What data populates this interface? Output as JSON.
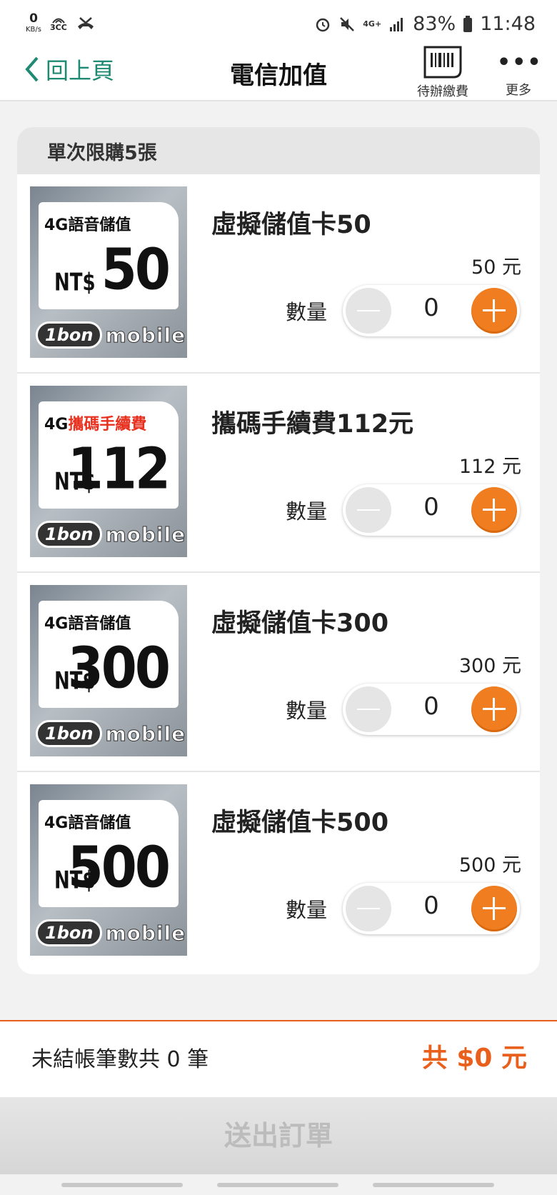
{
  "status_bar": {
    "speed_value": "0",
    "speed_unit": "KB/s",
    "cc_label": "3CC",
    "network": "4G+",
    "battery": "83%",
    "time": "11:48"
  },
  "header": {
    "back_label": "回上頁",
    "title": "電信加值",
    "pending_label": "待辦繳費",
    "more_label": "更多"
  },
  "card": {
    "limit_text": "單次限購5張",
    "qty_label": "數量",
    "items": [
      {
        "thumb_title": "4G語音儲值",
        "thumb_title_red": "",
        "thumb_prefix": "NT$",
        "thumb_amount": "50",
        "name": "虛擬儲值卡50",
        "price": "50 元",
        "qty": "0"
      },
      {
        "thumb_title": "4G",
        "thumb_title_red": "攜碼手續費",
        "thumb_prefix": "NT$",
        "thumb_amount": "112",
        "name": "攜碼手續費112元",
        "price": "112 元",
        "qty": "0"
      },
      {
        "thumb_title": "4G語音儲值",
        "thumb_title_red": "",
        "thumb_prefix": "NT$",
        "thumb_amount": "300",
        "name": "虛擬儲值卡300",
        "price": "300 元",
        "qty": "0"
      },
      {
        "thumb_title": "4G語音儲值",
        "thumb_title_red": "",
        "thumb_prefix": "NT$",
        "thumb_amount": "500",
        "name": "虛擬儲值卡500",
        "price": "500 元",
        "qty": "0"
      }
    ],
    "logo_pill": "1bon",
    "logo_word": "mobile"
  },
  "summary": {
    "left": "未結帳筆數共 0 筆",
    "right": "共 $0 元"
  },
  "submit_label": "送出訂單",
  "colors": {
    "accent": "#f07d1f",
    "brand_green": "#1f8a73",
    "total_orange": "#e8601c"
  }
}
